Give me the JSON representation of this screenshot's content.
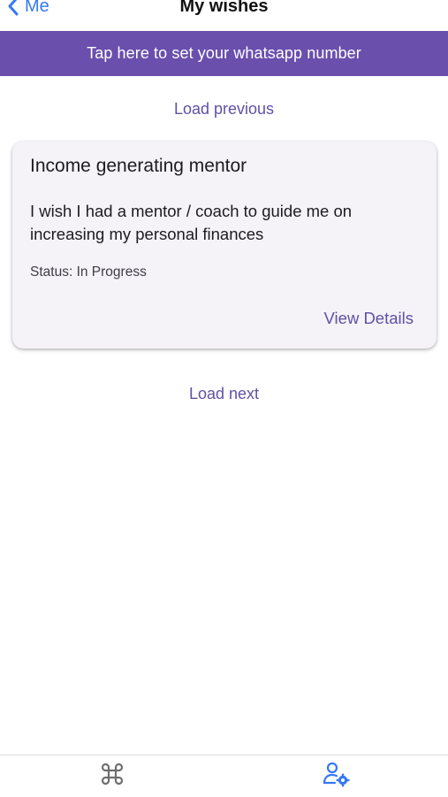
{
  "nav": {
    "back_label": "Me",
    "title": "My wishes"
  },
  "banner": {
    "text": "Tap here to set your whatsapp number"
  },
  "list": {
    "load_previous": "Load previous",
    "load_next": "Load next"
  },
  "wish_card": {
    "title": "Income generating mentor",
    "description": "I wish I had a mentor / coach to guide me on increasing my personal finances",
    "status_label": "Status:",
    "status_value": "In Progress",
    "action_label": "View Details"
  },
  "tabbar": {
    "tabs": [
      {
        "icon": "command-icon",
        "active": false
      },
      {
        "icon": "user-settings-icon",
        "active": true
      }
    ]
  },
  "colors": {
    "accent": "#6150a6",
    "banner": "#6a4fad",
    "ios_blue": "#3478f6",
    "inactive_icon": "#6e6e6e"
  }
}
